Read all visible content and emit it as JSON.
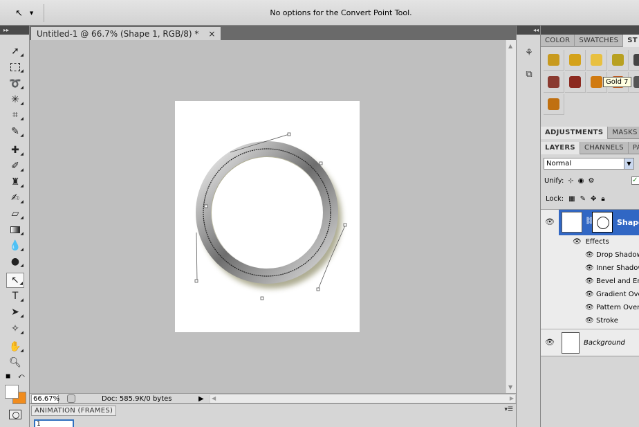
{
  "options_bar": {
    "tool_icon": "convert-point-arrow-icon",
    "message": "No options for the Convert Point Tool."
  },
  "document": {
    "tab_title": "Untitled-1 @ 66.7% (Shape 1, RGB/8) *",
    "close_glyph": "×"
  },
  "status_bar": {
    "zoom": "66.67%",
    "doc_info": "Doc: 585.9K/0 bytes"
  },
  "animation_panel": {
    "tab_label": "ANIMATION (FRAMES)",
    "frame_number": "1"
  },
  "right_panels": {
    "top_tabs": [
      "COLOR",
      "SWATCHES",
      "ST"
    ],
    "adjust_tabs": [
      "ADJUSTMENTS",
      "MASKS"
    ],
    "layer_tabs": [
      "LAYERS",
      "CHANNELS",
      "PA"
    ],
    "tooltip": "Gold 7",
    "blend_mode": "Normal",
    "unify_label": "Unify:",
    "lock_label": "Lock:",
    "style_colors": [
      "#c89a1e",
      "#d4a21a",
      "#e8c040",
      "#b8a020",
      "#444444",
      "#8a3a30",
      "#8c2a20",
      "#d07a10",
      "#c05a20",
      "#555555",
      "#c07010"
    ],
    "layers": {
      "shape_layer_name": "Shape",
      "effects_label": "Effects",
      "effects": [
        "Drop Shadow",
        "Inner Shadow",
        "Bevel and Emboss",
        "Gradient Overlay",
        "Pattern Overlay",
        "Stroke"
      ],
      "background_layer_name": "Background"
    }
  }
}
